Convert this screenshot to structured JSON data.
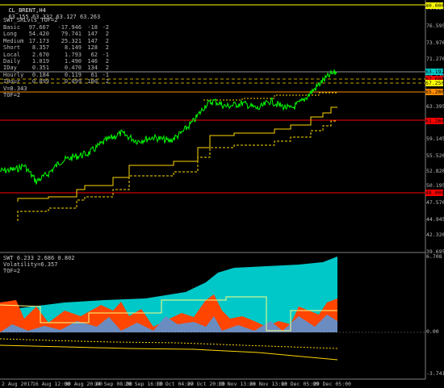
{
  "header": {
    "symbol": "CL_BRENT,H4",
    "ohlc": "63.155 63.332 63.127 63.263"
  },
  "indicator_top": {
    "title": "SWT_SRLvls_TOF=2",
    "rows": [
      {
        "name": "Basic",
        "v1": "97.667",
        "v2": "-17.946",
        "v3": "-18",
        "v4": "-2"
      },
      {
        "name": "Long",
        "v1": "54.420",
        "v2": "79.741",
        "v3": "147",
        "v4": "2"
      },
      {
        "name": "Medium",
        "v1": "17.173",
        "v2": "25.321",
        "v3": "147",
        "v4": "2"
      },
      {
        "name": "Short",
        "v1": "8.357",
        "v2": "8.149",
        "v3": "128",
        "v4": "2"
      },
      {
        "name": "Local",
        "v1": "2.670",
        "v2": "1.793",
        "v3": "62",
        "v4": "-1"
      },
      {
        "name": "Daily",
        "v1": "1.019",
        "v2": "1.490",
        "v3": "146",
        "v4": "2"
      },
      {
        "name": "IDay",
        "v1": "0.351",
        "v2": "0.470",
        "v3": "134",
        "v4": "2"
      },
      {
        "name": "Hourly",
        "v1": "0.184",
        "v2": "0.119",
        "v3": "61",
        "v4": "-1"
      },
      {
        "name": "IHour",
        "v1": "0.099",
        "v2": "0.099",
        "v3": "100",
        "v4": "2"
      }
    ],
    "v_label": "V=0.343",
    "tof_label": "TOF=2"
  },
  "indicator_bottom": {
    "title": "SWT 6.233 2.686 0.802",
    "volatility": "Volatility=6.357",
    "tof": "TOF=2"
  },
  "price_axis": [
    "79.220",
    "76.595",
    "73.970",
    "71.270",
    "68.645",
    "66.020",
    "63.395",
    "61.770",
    "59.145",
    "55.520",
    "52.820",
    "50.195",
    "47.570",
    "44.945",
    "42.320",
    "39.695"
  ],
  "price_tags": [
    {
      "text": "80.000",
      "color": "#ffff00"
    },
    {
      "text": "63.192",
      "color": "#00c8c8"
    },
    {
      "text": "62.680",
      "color": "#ff0000"
    },
    {
      "text": "67.250",
      "color": "#ffff00"
    },
    {
      "text": "65.200",
      "color": "#ff8c00"
    },
    {
      "text": "61.260",
      "color": "#ff0000"
    },
    {
      "text": "48.000",
      "color": "#ff0000"
    }
  ],
  "sub_axis": [
    "6.708",
    "0.00",
    "-3.741"
  ],
  "dates": [
    "2 Aug 2017",
    "16 Aug 12:00",
    "30 Aug 20:00",
    "14 Sep 08:00",
    "28 Sep 16:00",
    "13 Oct 04:00",
    "27 Oct 20:00",
    "13 Nov 13:00",
    "28 Nov 13:00",
    "13 Dec 05:00",
    "29 Dec 05:00"
  ],
  "colors": {
    "price": "#00ff00",
    "support": "#ffd700",
    "red_level": "#ff0000",
    "cyan_area": "#00c8c8",
    "orange_area": "#ff4500",
    "blue_area": "#6b8cc0"
  }
}
